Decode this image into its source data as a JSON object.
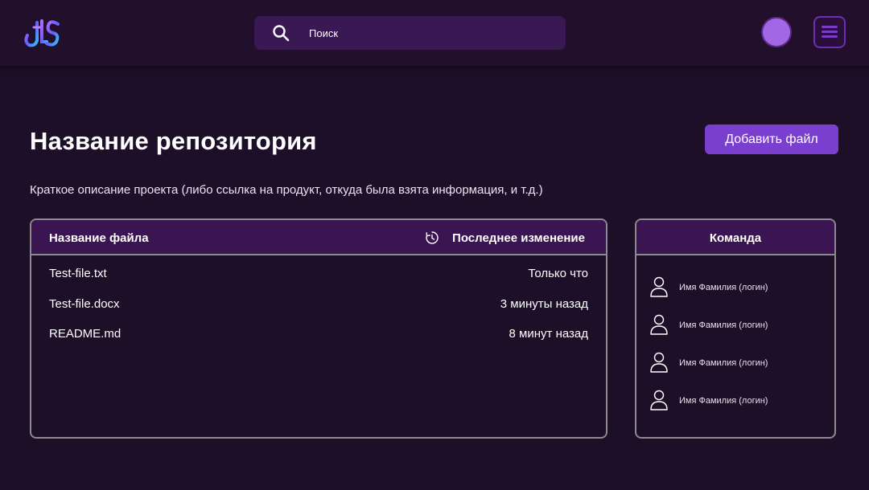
{
  "header": {
    "logo_icon": "logo-icon",
    "search": {
      "placeholder": "Поиск",
      "icon": "search-icon"
    },
    "avatar": {
      "color": "#a267e4"
    },
    "menu_icon": "hamburger-menu-icon"
  },
  "repo": {
    "title": "Название репозитория",
    "description": "Краткое описание проекта (либо ссылка на продукт, откуда была взята информация, и т.д.)",
    "add_file_label": "Добавить файл"
  },
  "files_table": {
    "header_name": "Название файла",
    "header_changed": "Последнее изменение",
    "history_icon": "history-icon",
    "rows": [
      {
        "name": "Test-file.txt",
        "changed": "Только что"
      },
      {
        "name": "Test-file.docx",
        "changed": "3 минуты назад"
      },
      {
        "name": "README.md",
        "changed": "8 минут назад"
      }
    ]
  },
  "team": {
    "title": "Команда",
    "members": [
      {
        "name": "Имя Фамилия (логин)"
      },
      {
        "name": "Имя Фамилия (логин)"
      },
      {
        "name": "Имя Фамилия (логин)"
      },
      {
        "name": "Имя Фамилия (логин)"
      }
    ]
  },
  "colors": {
    "background": "#1e0f29",
    "accent": "#7b3fd0",
    "panel_header": "#3b1551",
    "search_bg": "#3a1854"
  }
}
